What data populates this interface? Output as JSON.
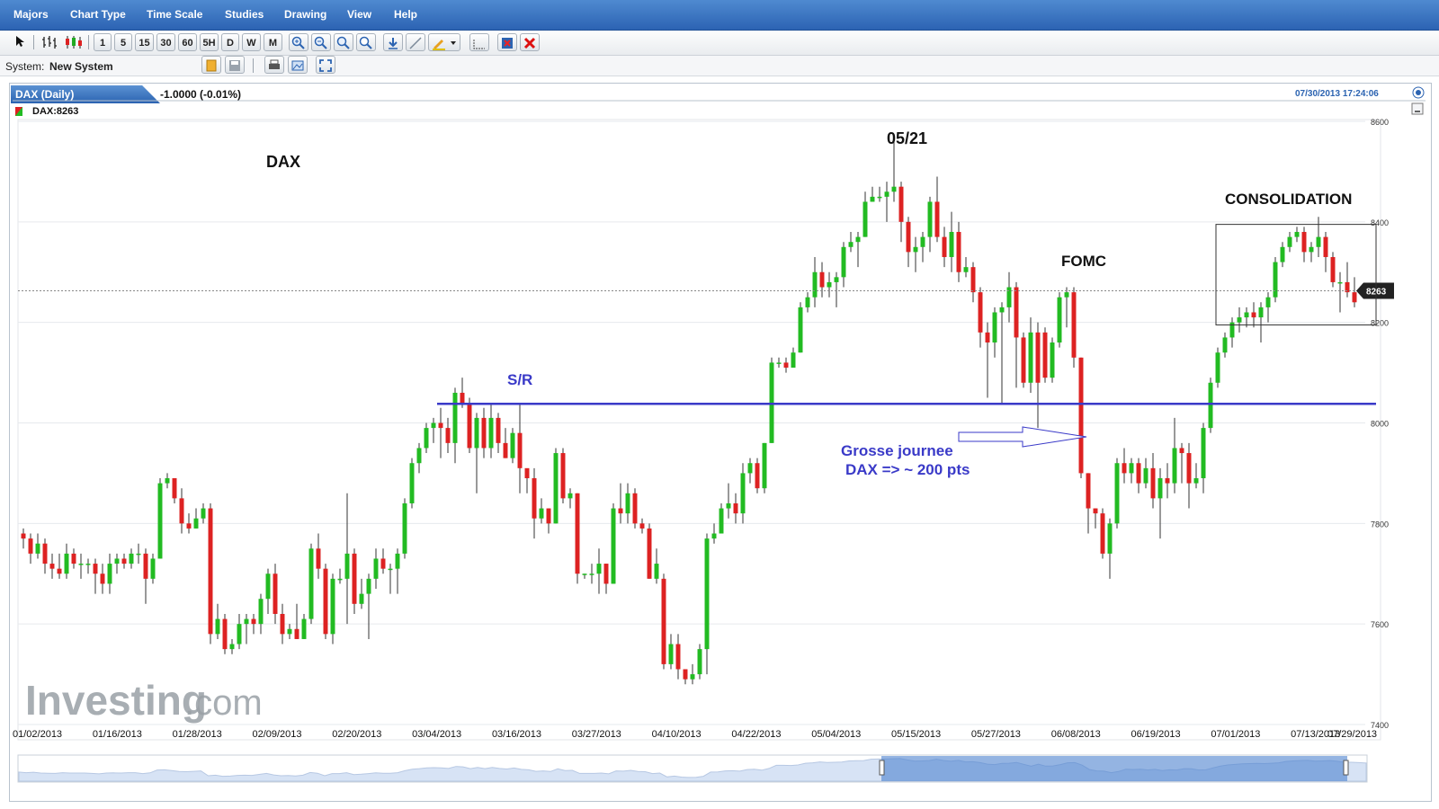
{
  "menu": [
    "Majors",
    "Chart Type",
    "Time Scale",
    "Studies",
    "Drawing",
    "View",
    "Help"
  ],
  "toolbar": {
    "intervals": [
      "1",
      "5",
      "15",
      "30",
      "60",
      "5H",
      "D",
      "W",
      "M"
    ]
  },
  "system": {
    "label": "System:",
    "value": "New System"
  },
  "instrument": {
    "tab": "DAX (Daily)",
    "change": "-1.0000 (-0.01%)",
    "legend": "DAX:8263",
    "timestamp": "07/30/2013 17:24:06"
  },
  "logo": {
    "text": "Investing",
    "suffix": ".com"
  },
  "chart_data": {
    "type": "candlestick",
    "title": "",
    "ylim": [
      7400,
      8600
    ],
    "yticks": [
      7400,
      7600,
      7800,
      8000,
      8200,
      8400,
      8600
    ],
    "xtick_labels": [
      "01/02/2013",
      "01/16/2013",
      "01/28/2013",
      "02/09/2013",
      "02/20/2013",
      "03/04/2013",
      "03/16/2013",
      "03/27/2013",
      "04/10/2013",
      "04/22/2013",
      "05/04/2013",
      "05/15/2013",
      "05/27/2013",
      "06/08/2013",
      "06/19/2013",
      "07/01/2013",
      "07/13/2013",
      "07/29/2013"
    ],
    "last_price": "8263",
    "sr_level": 8038,
    "consolidation": {
      "low": 8195,
      "high": 8395
    },
    "colors": {
      "up": "#22bb22",
      "down": "#dd2222",
      "sr": "#3a3ac8",
      "annotation": "#3a3ac8"
    },
    "annotations": {
      "dax": "DAX",
      "peak": "05/21",
      "sr": "S/R",
      "fomc": "FOMC",
      "consolidation": "CONSOLIDATION",
      "note1": "Grosse journee",
      "note2": "DAX =>  ~ 200 pts"
    },
    "candles": [
      [
        7780,
        7770,
        7790,
        7750
      ],
      [
        7770,
        7740,
        7780,
        7720
      ],
      [
        7740,
        7760,
        7780,
        7730
      ],
      [
        7760,
        7720,
        7770,
        7700
      ],
      [
        7720,
        7710,
        7740,
        7690
      ],
      [
        7710,
        7700,
        7740,
        7690
      ],
      [
        7700,
        7740,
        7760,
        7690
      ],
      [
        7740,
        7720,
        7750,
        7710
      ],
      [
        7720,
        7720,
        7740,
        7690
      ],
      [
        7720,
        7720,
        7730,
        7700
      ],
      [
        7720,
        7700,
        7730,
        7660
      ],
      [
        7700,
        7680,
        7720,
        7660
      ],
      [
        7680,
        7720,
        7740,
        7660
      ],
      [
        7720,
        7730,
        7740,
        7700
      ],
      [
        7730,
        7720,
        7740,
        7710
      ],
      [
        7720,
        7740,
        7750,
        7710
      ],
      [
        7740,
        7740,
        7760,
        7720
      ],
      [
        7740,
        7690,
        7750,
        7640
      ],
      [
        7690,
        7730,
        7740,
        7680
      ],
      [
        7730,
        7880,
        7890,
        7730
      ],
      [
        7880,
        7890,
        7900,
        7870
      ],
      [
        7890,
        7850,
        7890,
        7840
      ],
      [
        7850,
        7800,
        7870,
        7780
      ],
      [
        7800,
        7790,
        7820,
        7780
      ],
      [
        7790,
        7810,
        7830,
        7790
      ],
      [
        7810,
        7830,
        7840,
        7800
      ],
      [
        7830,
        7580,
        7840,
        7560
      ],
      [
        7580,
        7610,
        7640,
        7570
      ],
      [
        7610,
        7550,
        7620,
        7540
      ],
      [
        7550,
        7560,
        7570,
        7540
      ],
      [
        7560,
        7600,
        7620,
        7550
      ],
      [
        7600,
        7610,
        7620,
        7560
      ],
      [
        7610,
        7600,
        7620,
        7580
      ],
      [
        7600,
        7650,
        7660,
        7580
      ],
      [
        7650,
        7700,
        7710,
        7620
      ],
      [
        7700,
        7620,
        7720,
        7600
      ],
      [
        7620,
        7580,
        7640,
        7560
      ],
      [
        7580,
        7590,
        7600,
        7570
      ],
      [
        7590,
        7570,
        7640,
        7570
      ],
      [
        7570,
        7610,
        7620,
        7570
      ],
      [
        7610,
        7750,
        7760,
        7600
      ],
      [
        7750,
        7710,
        7780,
        7690
      ],
      [
        7710,
        7580,
        7720,
        7570
      ],
      [
        7580,
        7690,
        7700,
        7560
      ],
      [
        7690,
        7690,
        7710,
        7680
      ],
      [
        7690,
        7740,
        7860,
        7600
      ],
      [
        7740,
        7640,
        7750,
        7620
      ],
      [
        7640,
        7660,
        7690,
        7630
      ],
      [
        7660,
        7690,
        7700,
        7570
      ],
      [
        7690,
        7730,
        7750,
        7670
      ],
      [
        7730,
        7710,
        7750,
        7700
      ],
      [
        7710,
        7710,
        7720,
        7660
      ],
      [
        7710,
        7740,
        7750,
        7660
      ],
      [
        7740,
        7840,
        7850,
        7730
      ],
      [
        7840,
        7920,
        7930,
        7830
      ],
      [
        7920,
        7950,
        7960,
        7900
      ],
      [
        7950,
        7990,
        8000,
        7940
      ],
      [
        7990,
        8000,
        8010,
        7960
      ],
      [
        8000,
        7990,
        8030,
        7930
      ],
      [
        7990,
        7960,
        8010,
        7940
      ],
      [
        7960,
        8060,
        8070,
        7920
      ],
      [
        8060,
        8040,
        8090,
        8030
      ],
      [
        8040,
        7950,
        8050,
        7940
      ],
      [
        7950,
        8010,
        8020,
        7860
      ],
      [
        8010,
        7950,
        8030,
        7930
      ],
      [
        7950,
        8010,
        8040,
        7930
      ],
      [
        8010,
        7960,
        8020,
        7940
      ],
      [
        7960,
        7930,
        7990,
        7930
      ],
      [
        7930,
        7980,
        7990,
        7920
      ],
      [
        7980,
        7910,
        8040,
        7860
      ],
      [
        7910,
        7890,
        7900,
        7860
      ],
      [
        7890,
        7810,
        7910,
        7770
      ],
      [
        7810,
        7830,
        7850,
        7800
      ],
      [
        7830,
        7800,
        7830,
        7780
      ],
      [
        7800,
        7940,
        7950,
        7800
      ],
      [
        7940,
        7850,
        7950,
        7840
      ],
      [
        7850,
        7860,
        7870,
        7830
      ],
      [
        7860,
        7700,
        7860,
        7680
      ],
      [
        7700,
        7700,
        7700,
        7690
      ],
      [
        7700,
        7700,
        7720,
        7680
      ],
      [
        7700,
        7720,
        7750,
        7660
      ],
      [
        7720,
        7680,
        7720,
        7660
      ],
      [
        7680,
        7830,
        7840,
        7680
      ],
      [
        7830,
        7820,
        7880,
        7800
      ],
      [
        7820,
        7860,
        7880,
        7800
      ],
      [
        7860,
        7800,
        7870,
        7790
      ],
      [
        7800,
        7790,
        7810,
        7780
      ],
      [
        7790,
        7690,
        7800,
        7690
      ],
      [
        7690,
        7720,
        7750,
        7680
      ],
      [
        7690,
        7520,
        7700,
        7510
      ],
      [
        7520,
        7560,
        7580,
        7510
      ],
      [
        7560,
        7510,
        7580,
        7490
      ],
      [
        7510,
        7490,
        7510,
        7480
      ],
      [
        7490,
        7500,
        7520,
        7480
      ],
      [
        7500,
        7550,
        7560,
        7490
      ],
      [
        7550,
        7770,
        7780,
        7500
      ],
      [
        7770,
        7780,
        7800,
        7760
      ],
      [
        7780,
        7830,
        7840,
        7780
      ],
      [
        7830,
        7840,
        7880,
        7810
      ],
      [
        7840,
        7820,
        7860,
        7800
      ],
      [
        7820,
        7900,
        7920,
        7800
      ],
      [
        7900,
        7920,
        7930,
        7880
      ],
      [
        7920,
        7870,
        7930,
        7860
      ],
      [
        7870,
        7960,
        7960,
        7860
      ],
      [
        7960,
        8120,
        8130,
        7960
      ],
      [
        8120,
        8120,
        8130,
        8110
      ],
      [
        8120,
        8110,
        8130,
        8100
      ],
      [
        8110,
        8140,
        8150,
        8110
      ],
      [
        8140,
        8230,
        8240,
        8140
      ],
      [
        8230,
        8250,
        8260,
        8220
      ],
      [
        8250,
        8300,
        8330,
        8230
      ],
      [
        8300,
        8270,
        8320,
        8250
      ],
      [
        8270,
        8280,
        8300,
        8250
      ],
      [
        8280,
        8290,
        8300,
        8230
      ],
      [
        8290,
        8350,
        8360,
        8270
      ],
      [
        8350,
        8360,
        8380,
        8340
      ],
      [
        8360,
        8370,
        8380,
        8310
      ],
      [
        8370,
        8440,
        8460,
        8370
      ],
      [
        8440,
        8450,
        8470,
        8440
      ],
      [
        8450,
        8450,
        8470,
        8440
      ],
      [
        8450,
        8460,
        8480,
        8400
      ],
      [
        8460,
        8470,
        8560,
        8440
      ],
      [
        8470,
        8400,
        8480,
        8360
      ],
      [
        8400,
        8340,
        8410,
        8310
      ],
      [
        8340,
        8350,
        8370,
        8300
      ],
      [
        8350,
        8370,
        8380,
        8320
      ],
      [
        8370,
        8440,
        8450,
        8340
      ],
      [
        8440,
        8370,
        8490,
        8360
      ],
      [
        8370,
        8330,
        8390,
        8310
      ],
      [
        8330,
        8380,
        8420,
        8300
      ],
      [
        8380,
        8300,
        8400,
        8280
      ],
      [
        8300,
        8310,
        8330,
        8290
      ],
      [
        8310,
        8260,
        8320,
        8240
      ],
      [
        8260,
        8180,
        8270,
        8150
      ],
      [
        8180,
        8160,
        8200,
        8050
      ],
      [
        8160,
        8220,
        8230,
        8130
      ],
      [
        8220,
        8230,
        8240,
        8040
      ],
      [
        8230,
        8270,
        8300,
        8200
      ],
      [
        8270,
        8170,
        8280,
        8070
      ],
      [
        8170,
        8080,
        8180,
        8070
      ],
      [
        8080,
        8180,
        8210,
        8060
      ],
      [
        8180,
        8080,
        8200,
        7990
      ],
      [
        8180,
        8090,
        8190,
        8080
      ],
      [
        8090,
        8160,
        8170,
        8080
      ],
      [
        8160,
        8250,
        8260,
        8150
      ],
      [
        8250,
        8260,
        8270,
        8190
      ],
      [
        8260,
        8130,
        8270,
        8110
      ],
      [
        8130,
        7900,
        8130,
        7890
      ],
      [
        7900,
        7830,
        7900,
        7780
      ],
      [
        7830,
        7820,
        7830,
        7790
      ],
      [
        7820,
        7740,
        7830,
        7730
      ],
      [
        7740,
        7800,
        7810,
        7690
      ],
      [
        7800,
        7920,
        7930,
        7790
      ],
      [
        7920,
        7900,
        7950,
        7880
      ],
      [
        7900,
        7920,
        7930,
        7880
      ],
      [
        7920,
        7880,
        7930,
        7860
      ],
      [
        7880,
        7910,
        7930,
        7870
      ],
      [
        7910,
        7850,
        7940,
        7830
      ],
      [
        7850,
        7890,
        7910,
        7770
      ],
      [
        7890,
        7880,
        7920,
        7850
      ],
      [
        7880,
        7950,
        8010,
        7860
      ],
      [
        7950,
        7940,
        7960,
        7880
      ],
      [
        7940,
        7880,
        7960,
        7830
      ],
      [
        7880,
        7890,
        7920,
        7870
      ],
      [
        7890,
        7990,
        8000,
        7860
      ],
      [
        7990,
        8080,
        8090,
        7980
      ],
      [
        8080,
        8140,
        8150,
        8070
      ],
      [
        8140,
        8170,
        8180,
        8130
      ],
      [
        8170,
        8200,
        8210,
        8150
      ],
      [
        8200,
        8210,
        8230,
        8180
      ],
      [
        8210,
        8220,
        8230,
        8190
      ],
      [
        8220,
        8210,
        8240,
        8190
      ],
      [
        8210,
        8230,
        8240,
        8160
      ],
      [
        8230,
        8250,
        8260,
        8200
      ],
      [
        8250,
        8320,
        8330,
        8240
      ],
      [
        8320,
        8350,
        8360,
        8310
      ],
      [
        8350,
        8370,
        8380,
        8340
      ],
      [
        8370,
        8380,
        8390,
        8360
      ],
      [
        8380,
        8340,
        8390,
        8320
      ],
      [
        8340,
        8350,
        8360,
        8320
      ],
      [
        8350,
        8370,
        8410,
        8330
      ],
      [
        8370,
        8330,
        8380,
        8300
      ],
      [
        8330,
        8280,
        8340,
        8270
      ],
      [
        8280,
        8280,
        8300,
        8220
      ],
      [
        8280,
        8260,
        8320,
        8250
      ],
      [
        8260,
        8240,
        8290,
        8230
      ]
    ]
  }
}
